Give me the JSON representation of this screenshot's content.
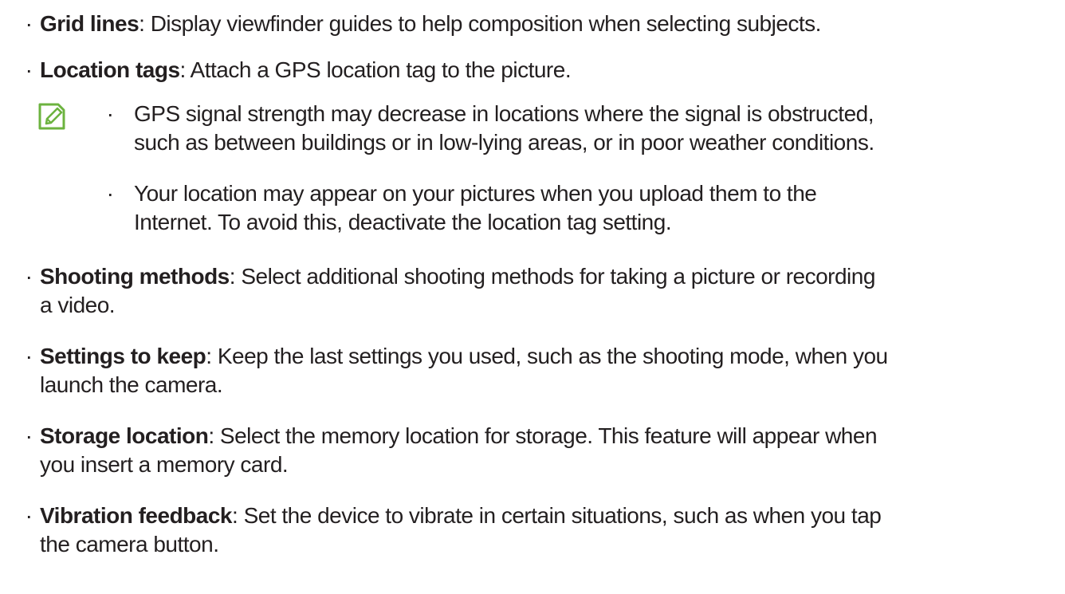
{
  "bullet_char": "·",
  "items": [
    {
      "term": "Grid lines",
      "desc": ": Display viewfinder guides to help composition when selecting subjects."
    },
    {
      "term": "Location tags",
      "desc": ": Attach a GPS location tag to the picture."
    },
    {
      "term": "Shooting methods",
      "desc_line1": ": Select additional shooting methods for taking a picture or recording",
      "desc_line2": "a video."
    },
    {
      "term": "Settings to keep",
      "desc_line1": ": Keep the last settings you used, such as the shooting mode, when you",
      "desc_line2": "launch the camera."
    },
    {
      "term": "Storage location",
      "desc_line1": ": Select the memory location for storage. This feature will appear when",
      "desc_line2": "you insert a memory card."
    },
    {
      "term": "Vibration feedback",
      "desc_line1": ": Set the device to vibrate in certain situations, such as when you tap",
      "desc_line2": "the camera button."
    }
  ],
  "note": {
    "icon": "note-pencil-icon",
    "icon_color": "#6cb33f",
    "sub_items": [
      {
        "line1": "GPS signal strength may decrease in locations where the signal is obstructed,",
        "line2": "such as between buildings or in low-lying areas, or in poor weather conditions."
      },
      {
        "line1": "Your location may appear on your pictures when you upload them to the",
        "line2": "Internet. To avoid this, deactivate the location tag setting."
      }
    ]
  }
}
